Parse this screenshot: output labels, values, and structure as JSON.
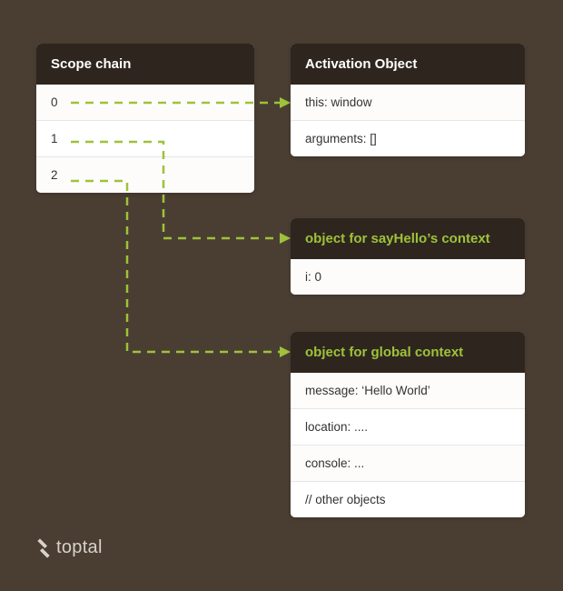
{
  "colors": {
    "background": "#4a3e33",
    "cardHeader": "#2e261e",
    "accent": "#9ec23a",
    "card": "#ffffff"
  },
  "scope": {
    "title": "Scope chain",
    "rows": [
      "0",
      "1",
      "2"
    ]
  },
  "activation": {
    "title": "Activation Object",
    "rows": [
      "this: window",
      "arguments: []"
    ]
  },
  "sayHello": {
    "title": "object for sayHello’s context",
    "rows": [
      "i: 0"
    ]
  },
  "global": {
    "title": "object for global context",
    "rows": [
      "message: ‘Hello World’",
      "location: ....",
      "console: ...",
      " // other objects"
    ]
  },
  "brand": "toptal",
  "connections": [
    {
      "from_scope_index": 0,
      "to_target": "activation.rows.0"
    },
    {
      "from_scope_index": 1,
      "to_target": "sayHello.title"
    },
    {
      "from_scope_index": 2,
      "to_target": "global.title"
    }
  ]
}
